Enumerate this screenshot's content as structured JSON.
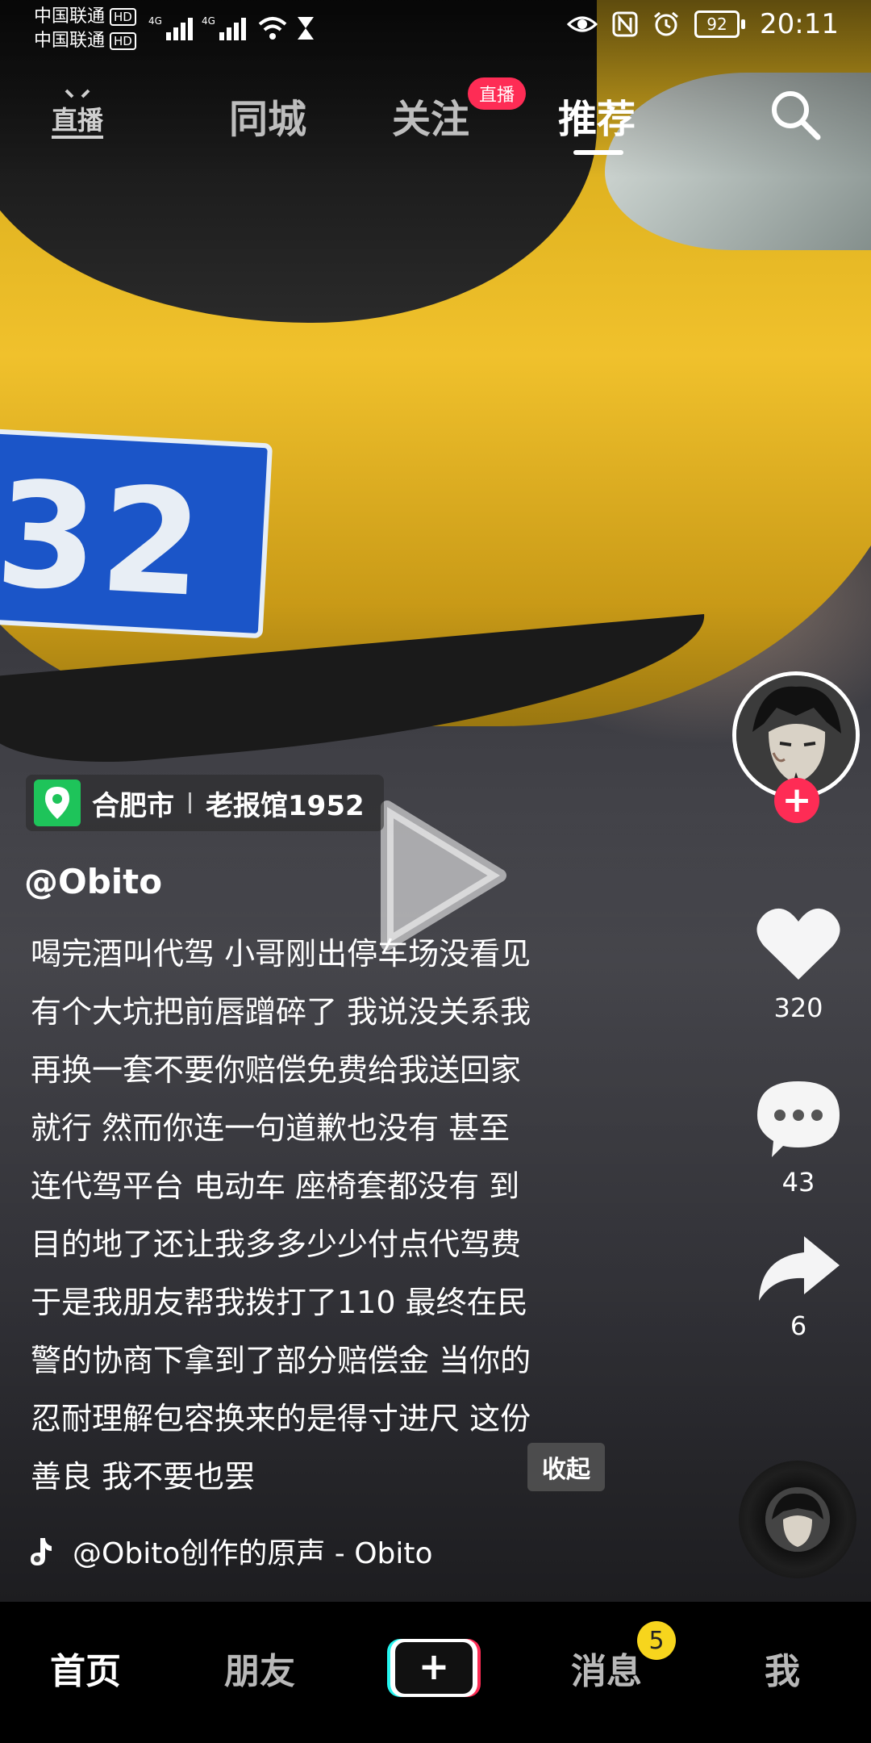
{
  "status_bar": {
    "carrier_1": "中国联通",
    "carrier_2": "中国联通",
    "hd": "HD",
    "net_1": "4G",
    "net_2": "4G",
    "battery": "92",
    "time": "20:11"
  },
  "top_nav": {
    "live_icon_label": "直播",
    "tabs": [
      {
        "label": "同城"
      },
      {
        "label": "关注"
      },
      {
        "label": "推荐"
      }
    ],
    "live_badge": "直播",
    "active_tab": "推荐"
  },
  "video": {
    "plate_text": "32"
  },
  "location": {
    "city": "合肥市",
    "place": "老报馆1952"
  },
  "author": {
    "username": "@Obito"
  },
  "caption": {
    "lines": [
      "喝完酒叫代驾 小哥刚出停车场没看见",
      "有个大坑把前唇蹭碎了 我说没关系我",
      "再换一套不要你赔偿免费给我送回家",
      "就行 然而你连一句道歉也没有 甚至",
      "连代驾平台 电动车 座椅套都没有 到",
      "目的地了还让我多多少少付点代驾费",
      "于是我朋友帮我拨打了110 最终在民",
      "警的协商下拿到了部分赔偿金 当你的",
      "忍耐理解包容换来的是得寸进尺 这份",
      "善良 我不要也罢"
    ],
    "collapse_label": "收起"
  },
  "music": {
    "text": "@Obito创作的原声 - Obito"
  },
  "actions": {
    "likes": "320",
    "comments": "43",
    "shares": "6",
    "follow_symbol": "+"
  },
  "bottom_nav": {
    "home": "首页",
    "friends": "朋友",
    "plus": "+",
    "messages": "消息",
    "messages_badge": "5",
    "me": "我"
  },
  "colors": {
    "accent": "#fe2c55",
    "location_green": "#1ec45a",
    "badge_yellow": "#f7d51d"
  }
}
